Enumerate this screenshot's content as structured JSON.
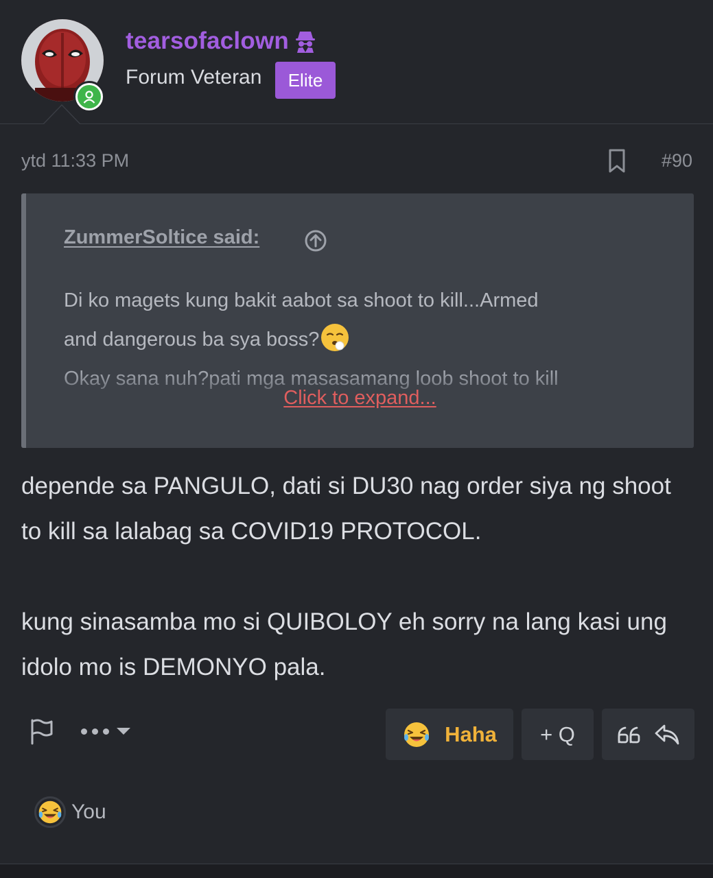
{
  "author": {
    "username": "tearsofaclown",
    "title": "Forum Veteran",
    "badge": "Elite",
    "status": "online",
    "name_color": "#a25ee0",
    "badge_color": "#9b59d8"
  },
  "post": {
    "time": "ytd 11:33 PM",
    "number": "#90"
  },
  "quote": {
    "author": "ZummerSoltice said:",
    "line1": "Di ko magets kung bakit aabot sa shoot to kill...Armed",
    "line2": "and dangerous ba sya boss?",
    "line3": "Okay sana nuh?pati mga masasamang loob shoot to kill",
    "expand": "Click to expand..."
  },
  "message": {
    "paragraph1": "depende sa PANGULO, dati si DU30 nag order siya ng shoot to kill sa lalabag sa COVID19 PROTOCOL.",
    "paragraph2": "kung sinasamba mo si QUIBOLOY eh sorry na lang kasi ung idolo mo is DEMONYO pala."
  },
  "actions": {
    "reaction_label": "Haha",
    "multiquote_label": "+ Q",
    "reaction_color": "#f0b23a"
  },
  "reactions": {
    "summary": "You"
  },
  "icons": [
    "spy-icon",
    "bookmark-icon",
    "arrow-up-circle-icon",
    "sleepy-face-emoji",
    "flag-icon",
    "more-icon",
    "laughing-emoji",
    "quote-icon",
    "reply-icon"
  ]
}
